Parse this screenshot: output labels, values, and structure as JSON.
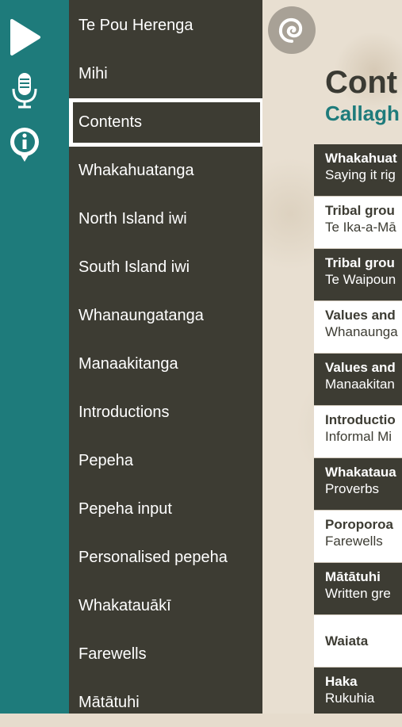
{
  "menu": {
    "items": [
      {
        "label": "Te Pou Herenga"
      },
      {
        "label": "Mihi"
      },
      {
        "label": "Contents"
      },
      {
        "label": "Whakahuatanga"
      },
      {
        "label": "North Island iwi"
      },
      {
        "label": "South Island iwi"
      },
      {
        "label": "Whanaungatanga"
      },
      {
        "label": "Manaakitanga"
      },
      {
        "label": "Introductions"
      },
      {
        "label": "Pepeha"
      },
      {
        "label": "Pepeha input"
      },
      {
        "label": "Personalised pepeha"
      },
      {
        "label": "Whakatauākī"
      },
      {
        "label": "Farewells"
      },
      {
        "label": "Mātātuhi"
      }
    ],
    "selected_index": 2
  },
  "rail": {
    "icons": [
      "play-icon",
      "microphone-icon",
      "info-icon"
    ]
  },
  "content": {
    "title": "Cont",
    "subtitle": "Callagh",
    "rows": [
      {
        "title": "Whakahuat",
        "subtitle": "Saying it rig",
        "style": "dark"
      },
      {
        "title": "Tribal grou",
        "subtitle": "Te Ika-a-Mā",
        "style": "light"
      },
      {
        "title": "Tribal grou",
        "subtitle": "Te Waipoun",
        "style": "dark"
      },
      {
        "title": "Values and",
        "subtitle": "Whanaunga",
        "style": "light"
      },
      {
        "title": "Values and",
        "subtitle": "Manaakitan",
        "style": "dark"
      },
      {
        "title": "Introductio",
        "subtitle": "Informal Mi",
        "style": "light"
      },
      {
        "title": "Whakataua",
        "subtitle": "Proverbs",
        "style": "dark"
      },
      {
        "title": "Poroporoa",
        "subtitle": "Farewells",
        "style": "light"
      },
      {
        "title": "Mātātuhi",
        "subtitle": "Written gre",
        "style": "dark"
      },
      {
        "title": "Waiata",
        "subtitle": "",
        "style": "light"
      },
      {
        "title": "Haka",
        "subtitle": "Rukuhia",
        "style": "dark"
      }
    ]
  },
  "colors": {
    "rail": "#1e7b7b",
    "menu": "#3d3c33",
    "accent": "#1e7b7b"
  }
}
